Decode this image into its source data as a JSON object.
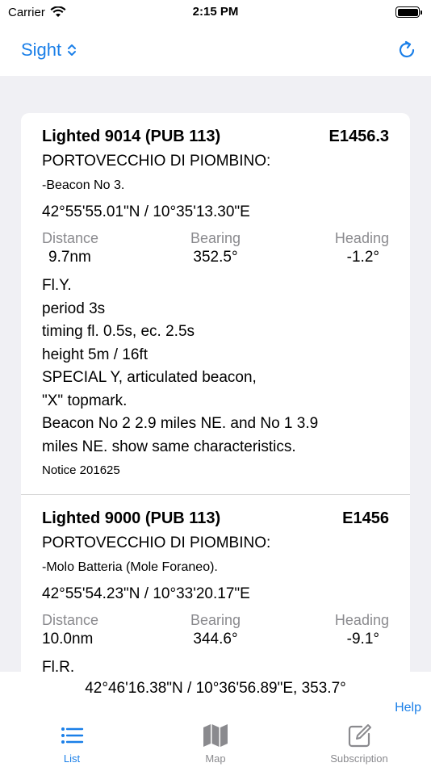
{
  "status_bar": {
    "carrier": "Carrier",
    "time": "2:15 PM"
  },
  "nav": {
    "title": "Sight"
  },
  "entries": [
    {
      "name": "Lighted 9014 (PUB 113)",
      "code": "E1456.3",
      "location": "PORTOVECCHIO DI PIOMBINO:",
      "sublocation": "-Beacon No 3.",
      "coords": "42°55'55.01\"N / 10°35'13.30\"E",
      "distance_label": "Distance",
      "distance": "9.7nm",
      "bearing_label": "Bearing",
      "bearing": "352.5°",
      "heading_label": "Heading",
      "heading": "-1.2°",
      "desc": [
        "Fl.Y.",
        "period  3s",
        "timing  fl. 0.5s, ec. 2.5s",
        "height  5m / 16ft",
        "SPECIAL Y, articulated beacon,",
        "\"X\" topmark.",
        "Beacon No 2 2.9 miles NE. and No 1 3.9",
        "miles NE. show same characteristics."
      ],
      "notice": "Notice 201625"
    },
    {
      "name": "Lighted 9000 (PUB 113)",
      "code": "E1456",
      "location": "PORTOVECCHIO DI PIOMBINO:",
      "sublocation": "-Molo Batteria (Mole Foraneo).",
      "coords": "42°55'54.23\"N / 10°33'20.17\"E",
      "distance_label": "Distance",
      "distance": "10.0nm",
      "bearing_label": "Bearing",
      "bearing": "344.6°",
      "heading_label": "Heading",
      "heading": "-9.1°",
      "desc": [
        "Fl.R."
      ]
    }
  ],
  "bottom": {
    "position": "42°46'16.38\"N / 10°36'56.89\"E, 353.7°",
    "help": "Help"
  },
  "tabs": [
    {
      "label": "List",
      "icon": "list-icon",
      "active": true
    },
    {
      "label": "Map",
      "icon": "map-icon",
      "active": false
    },
    {
      "label": "Subscription",
      "icon": "compose-icon",
      "active": false
    }
  ],
  "colors": {
    "accent": "#1a7fe8",
    "secondary_text": "#8a8a8e",
    "background": "#f0f0f4"
  }
}
